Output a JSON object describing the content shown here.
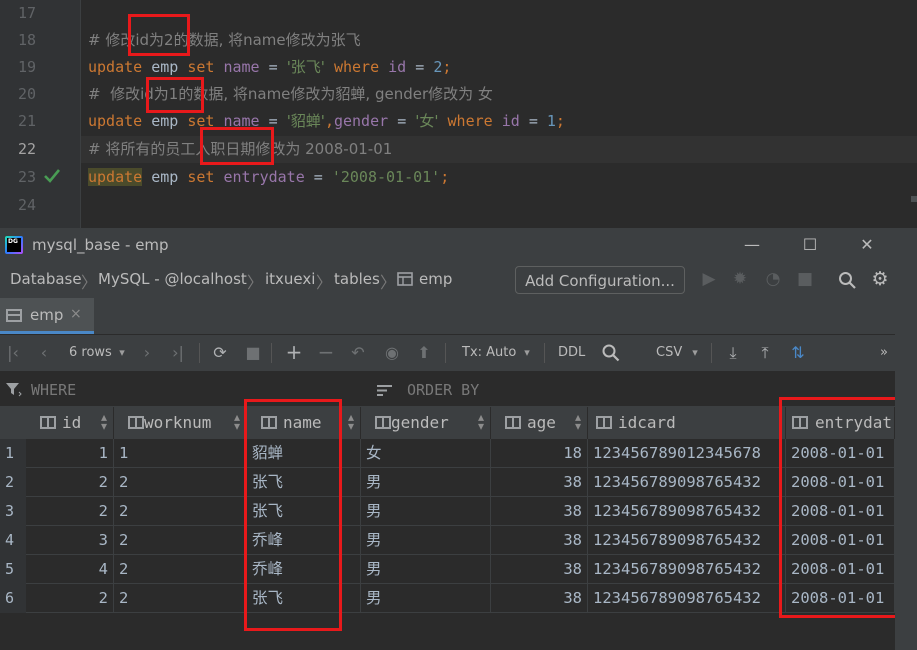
{
  "editor": {
    "line_numbers": [
      "17",
      "18",
      "19",
      "20",
      "21",
      "22",
      "23",
      "24"
    ],
    "lines": [
      {
        "comment": "# 修改id为2的数据, 将name修改为张飞"
      },
      {
        "kw1": "update",
        "table": "emp",
        "kw2": "set",
        "col1": "name",
        "eq1": "=",
        "val1": "'张飞'",
        "kw3": "where",
        "col2": "id",
        "eq2": "=",
        "val2": "2",
        "end": ";"
      },
      {
        "comment": "#  修改id为1的数据, 将name修改为貂蝉, gender修改为 女"
      },
      {
        "kw1": "update",
        "table": "emp",
        "kw2": "set",
        "col1": "name",
        "eq1": "=",
        "val1": "'貂蝉'",
        "comma": ",",
        "col1b": "gender",
        "eq1b": "=",
        "val1b": "'女'",
        "kw3": "where",
        "col2": "id",
        "eq2": "=",
        "val2": "1",
        "end": ";"
      },
      {
        "comment": "# 将所有的员工入职日期修改为 2008-01-01"
      },
      {
        "kw1": "update",
        "table": "emp",
        "kw2": "set",
        "col1": "entrydate",
        "eq1": "=",
        "val1": "'2008-01-01'",
        "end": ";"
      }
    ]
  },
  "window": {
    "title": "mysql_base - emp",
    "logo": "DG",
    "minimize": "—",
    "maximize": "☐",
    "close": "✕"
  },
  "breadcrumb": {
    "items": [
      "Database",
      "MySQL - @localhost",
      "itxuexi",
      "tables",
      "emp"
    ],
    "sep": "〉"
  },
  "run_config": {
    "label": "Add Configuration..."
  },
  "tab": {
    "label": "emp",
    "close": "×"
  },
  "grid_toolbar": {
    "rows": "6 rows",
    "tx": "Tx: Auto",
    "ddl": "DDL",
    "format": "CSV"
  },
  "filter": {
    "where": "WHERE",
    "order_by": "ORDER BY"
  },
  "table": {
    "columns": [
      "id",
      "worknum",
      "name",
      "gender",
      "age",
      "idcard",
      "entrydat"
    ],
    "rows": [
      {
        "n": "1",
        "id": "1",
        "worknum": "1",
        "name": "貂蝉",
        "gender": "女",
        "age": "18",
        "idcard": "123456789012345678",
        "entrydate": "2008-01-01"
      },
      {
        "n": "2",
        "id": "2",
        "worknum": "2",
        "name": "张飞",
        "gender": "男",
        "age": "38",
        "idcard": "123456789098765432",
        "entrydate": "2008-01-01"
      },
      {
        "n": "3",
        "id": "2",
        "worknum": "2",
        "name": "张飞",
        "gender": "男",
        "age": "38",
        "idcard": "123456789098765432",
        "entrydate": "2008-01-01"
      },
      {
        "n": "4",
        "id": "3",
        "worknum": "2",
        "name": "乔峰",
        "gender": "男",
        "age": "38",
        "idcard": "123456789098765432",
        "entrydate": "2008-01-01"
      },
      {
        "n": "5",
        "id": "4",
        "worknum": "2",
        "name": "乔峰",
        "gender": "男",
        "age": "38",
        "idcard": "123456789098765432",
        "entrydate": "2008-01-01"
      },
      {
        "n": "6",
        "id": "2",
        "worknum": "2",
        "name": "张飞",
        "gender": "男",
        "age": "38",
        "idcard": "123456789098765432",
        "entrydate": "2008-01-01"
      }
    ]
  },
  "colors": {
    "annotation_red": "#e8191b",
    "keyword": "#cc7832",
    "string": "#6a8759",
    "number": "#6897bb",
    "column": "#9876aa"
  }
}
